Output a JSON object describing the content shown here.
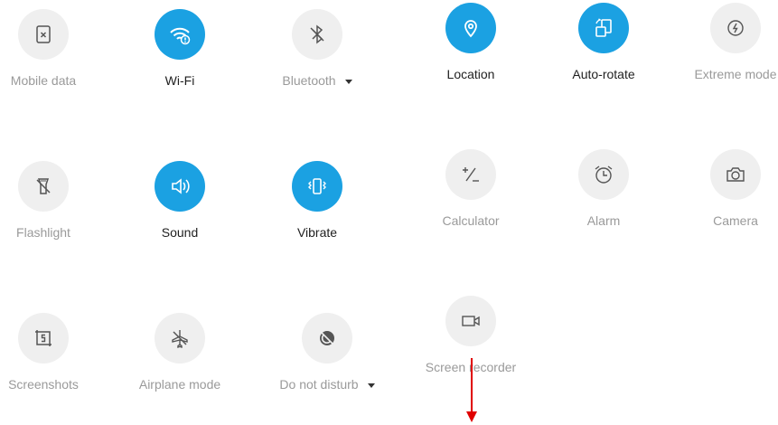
{
  "tiles_left": [
    {
      "label": "Mobile data",
      "icon": "mobile-data-icon",
      "on": false
    },
    {
      "label": "Wi-Fi",
      "icon": "wifi-icon",
      "on": true
    },
    {
      "label": "Bluetooth",
      "icon": "bluetooth-icon",
      "on": false,
      "dropdown": true
    },
    {
      "label": "Flashlight",
      "icon": "flashlight-icon",
      "on": false
    },
    {
      "label": "Sound",
      "icon": "sound-icon",
      "on": true
    },
    {
      "label": "Vibrate",
      "icon": "vibrate-icon",
      "on": true
    },
    {
      "label": "Screenshots",
      "icon": "screenshot-icon",
      "on": false
    },
    {
      "label": "Airplane mode",
      "icon": "airplane-icon",
      "on": false
    },
    {
      "label": "Do not disturb",
      "icon": "do-not-disturb-icon",
      "on": false,
      "dropdown": true
    }
  ],
  "tiles_right": [
    {
      "label": "Location",
      "icon": "location-icon",
      "on": true
    },
    {
      "label": "Auto-rotate",
      "icon": "auto-rotate-icon",
      "on": true
    },
    {
      "label": "Extreme mode",
      "icon": "extreme-mode-icon",
      "on": false
    },
    {
      "label": "Calculator",
      "icon": "calculator-icon",
      "on": false
    },
    {
      "label": "Alarm",
      "icon": "alarm-icon",
      "on": false
    },
    {
      "label": "Camera",
      "icon": "camera-icon",
      "on": false
    },
    {
      "label": "Screen recorder",
      "icon": "screen-recorder-icon",
      "on": false
    }
  ],
  "colors": {
    "active": "#1ba1e2",
    "inactive_bg": "#efefef",
    "annotation_arrow": "#e00000"
  }
}
